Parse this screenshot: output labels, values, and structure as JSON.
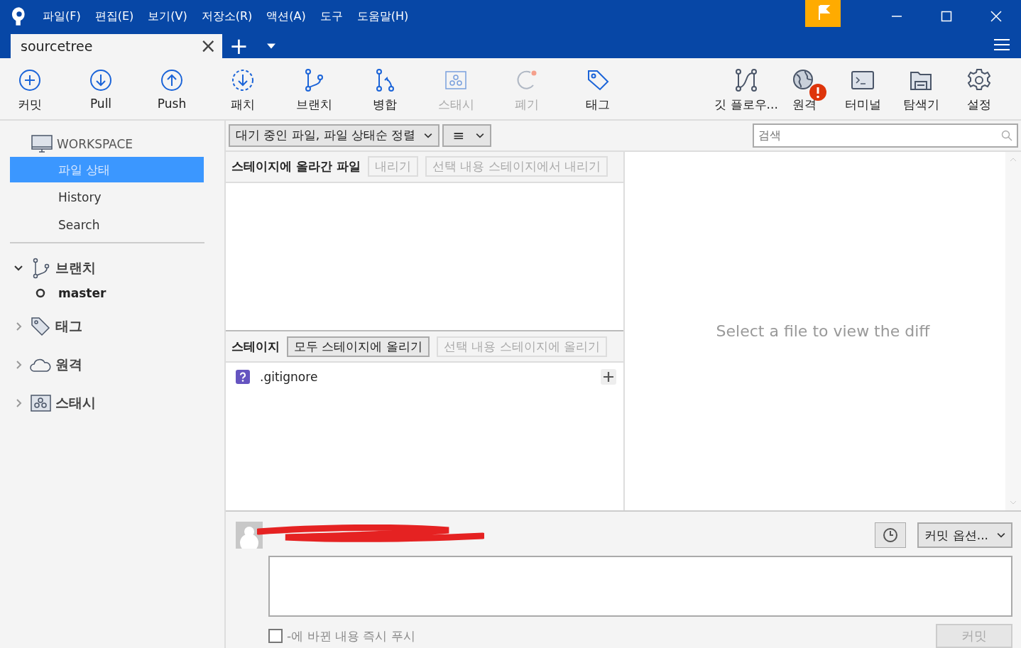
{
  "menu": [
    "파일(F)",
    "편집(E)",
    "보기(V)",
    "저장소(R)",
    "액션(A)",
    "도구",
    "도움말(H)"
  ],
  "tab": {
    "title": "sourcetree",
    "close": "×",
    "add": "+"
  },
  "toolbar": {
    "left": [
      {
        "label": "커밋",
        "kind": "commit",
        "disabled": false,
        "alert": false
      },
      {
        "label": "Pull",
        "kind": "pull",
        "disabled": false,
        "alert": false
      },
      {
        "label": "Push",
        "kind": "push",
        "disabled": false,
        "alert": false
      },
      {
        "label": "패치",
        "kind": "patch",
        "disabled": false,
        "alert": false
      },
      {
        "label": "브랜치",
        "kind": "branch",
        "disabled": false,
        "alert": false
      },
      {
        "label": "병합",
        "kind": "merge",
        "disabled": false,
        "alert": false
      },
      {
        "label": "스태시",
        "kind": "stash",
        "disabled": true,
        "alert": false
      },
      {
        "label": "폐기",
        "kind": "discard",
        "disabled": true,
        "alert": false
      },
      {
        "label": "태그",
        "kind": "tag",
        "disabled": false,
        "alert": false
      }
    ],
    "right": [
      {
        "label": "깃 플로우...",
        "kind": "gitflow",
        "disabled": false,
        "alert": false
      },
      {
        "label": "원격",
        "kind": "remote",
        "disabled": false,
        "alert": true
      },
      {
        "label": "터미널",
        "kind": "terminal",
        "disabled": false,
        "alert": false
      },
      {
        "label": "탐색기",
        "kind": "explorer",
        "disabled": false,
        "alert": false
      },
      {
        "label": "설정",
        "kind": "settings",
        "disabled": false,
        "alert": false
      }
    ]
  },
  "sidebar": {
    "workspace": {
      "title": "WORKSPACE",
      "items": [
        {
          "label": "파일 상태",
          "selected": true
        },
        {
          "label": "History",
          "selected": false
        },
        {
          "label": "Search",
          "selected": false
        }
      ]
    },
    "groups": [
      {
        "label": "브랜치",
        "kind": "branch",
        "expanded": true,
        "children": [
          {
            "label": "master"
          }
        ]
      },
      {
        "label": "태그",
        "kind": "tag",
        "expanded": false
      },
      {
        "label": "원격",
        "kind": "remote",
        "expanded": false
      },
      {
        "label": "스태시",
        "kind": "stash",
        "expanded": false
      }
    ]
  },
  "filter": {
    "sort": "대기 중인 파일, 파일 상태순 정렬",
    "view": "≡"
  },
  "search": {
    "placeholder": "검색"
  },
  "staged": {
    "title": "스테이지에 올라간 파일",
    "buttons": [
      {
        "label": "내리기",
        "disabled": true
      },
      {
        "label": "선택 내용 스테이지에서 내리기",
        "disabled": true
      }
    ]
  },
  "unstaged": {
    "title": "스테이지",
    "buttons": [
      {
        "label": "모두 스테이지에 올리기",
        "disabled": false
      },
      {
        "label": "선택 내용 스테이지에 올리기",
        "disabled": true
      }
    ],
    "files": [
      {
        "name": ".gitignore"
      }
    ]
  },
  "diff": {
    "message": "Select a file to view the diff"
  },
  "commit": {
    "options": "커밋 옵션...",
    "push_option": {
      "label": "-에 바뀐 내용 즉시 푸시",
      "checked": false
    },
    "button": {
      "label": "커밋",
      "disabled": true
    }
  }
}
